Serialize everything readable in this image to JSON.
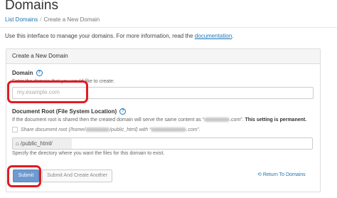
{
  "header": {
    "title": "Domains",
    "breadcrumb": {
      "link": "List Domains",
      "separator": "/",
      "current": "Create a New Domain"
    },
    "intro_text": "Use this interface to manage your domains. For more information, read the ",
    "intro_link": "documentation",
    "intro_end": "."
  },
  "panel": {
    "heading": "Create a New Domain",
    "domain": {
      "label": "Domain",
      "hint": "Enter the domain that you would like to create:",
      "placeholder": "my.example.com",
      "value": ""
    },
    "docroot": {
      "label": "Document Root (File System Location)",
      "hint_a": "If the document root is shared then the created domain will serve the same content as “",
      "hint_b": ".com”. ",
      "hint_bold": "This setting is permanent.",
      "share_a": "Share document root (/home/",
      "share_b": "/public_html) with “",
      "share_c": ".com”.",
      "share_checked": false,
      "prefix": "/public_html/",
      "value": "",
      "help": "Specify the directory where you want the files for this domain to exist."
    },
    "buttons": {
      "submit": "Submit",
      "submit_another": "Submit And Create Another",
      "return": "Return To Domains"
    }
  },
  "icons": {
    "help": "help-circle-icon",
    "home": "home-icon",
    "return": "circle-arrow-left-icon"
  },
  "colors": {
    "link": "#1a74b6",
    "primary_button": "#6e9ad0",
    "annotation": "#e11b22"
  }
}
